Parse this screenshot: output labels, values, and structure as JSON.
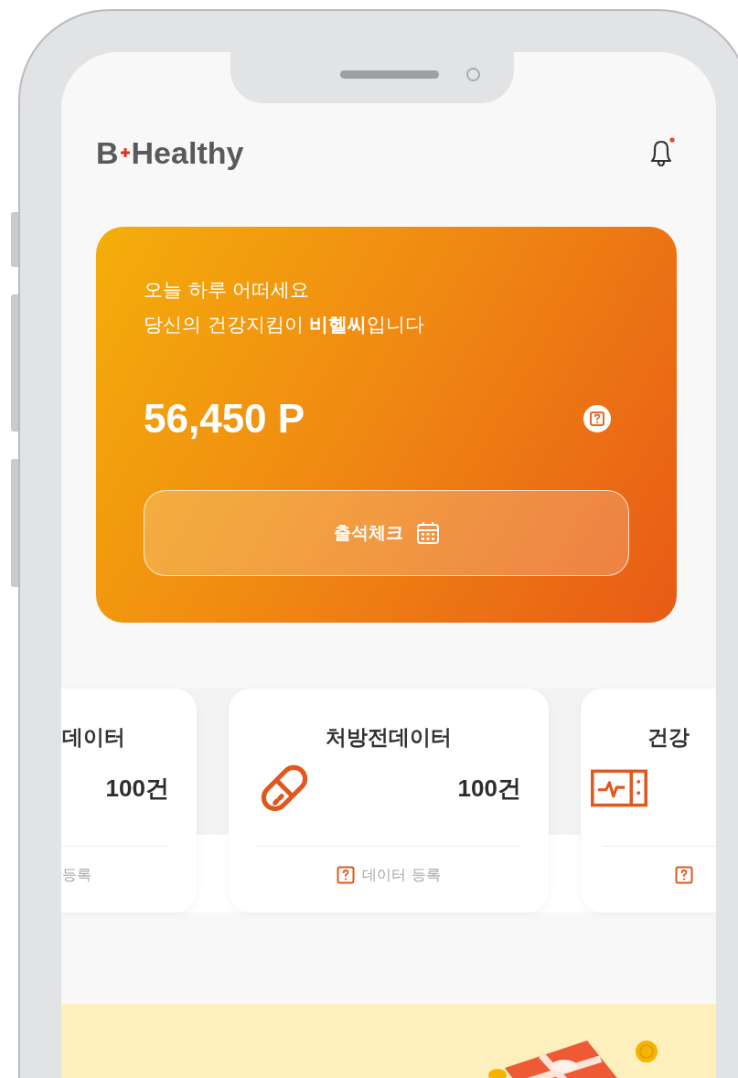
{
  "header": {
    "logo_left": "B",
    "logo_right": "Healthy",
    "notifications": {
      "unread": true
    }
  },
  "hero": {
    "greeting": [
      "오늘 하루 어떠세요",
      "당신의 건강지킴이 **비헬씨**입니다"
    ],
    "points": "56,450 P",
    "button": "출석체크"
  },
  "data_cards": [
    {
      "kind": "none",
      "title": "데이터",
      "count": "100건",
      "footer": {
        "text": "등록"
      }
    },
    {
      "kind": "pill",
      "title": "처방전데이터",
      "count": "100건",
      "footer": {
        "help_icon": true,
        "text": "데이터 등록"
      }
    },
    {
      "kind": "monitor",
      "title": "건강",
      "footer": {
        "help_icon": true
      }
    }
  ]
}
